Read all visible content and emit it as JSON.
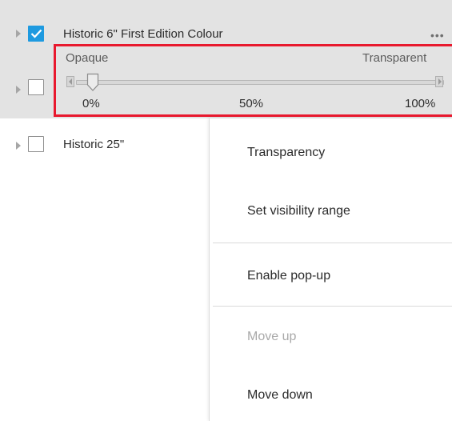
{
  "layers": [
    {
      "title": "Historic 6\" First Edition Colour",
      "checked": true
    },
    {
      "title": "",
      "checked": false
    },
    {
      "title": "Historic 25\"",
      "checked": false
    }
  ],
  "more_options_label": "•••",
  "transparency_slider": {
    "left_label": "Opaque",
    "right_label": "Transparent",
    "value_percent": 0,
    "ticks": [
      "0%",
      "50%",
      "100%"
    ]
  },
  "context_menu": {
    "items": [
      {
        "label": "Transparency",
        "enabled": true
      },
      {
        "label": "Set visibility range",
        "enabled": true
      },
      {
        "label": "Enable pop-up",
        "enabled": true
      },
      {
        "label": "Move up",
        "enabled": false
      },
      {
        "label": "Move down",
        "enabled": true
      }
    ]
  },
  "colors": {
    "highlight_border": "#e8192e",
    "checkbox_checked": "#1e9ae0",
    "selected_row_bg": "#e3e3e3"
  },
  "icons": [
    "expand-arrow-icon",
    "checkmark-icon",
    "more-options-icon",
    "slider-left-arrow-icon",
    "slider-right-arrow-icon",
    "slider-thumb-icon"
  ]
}
